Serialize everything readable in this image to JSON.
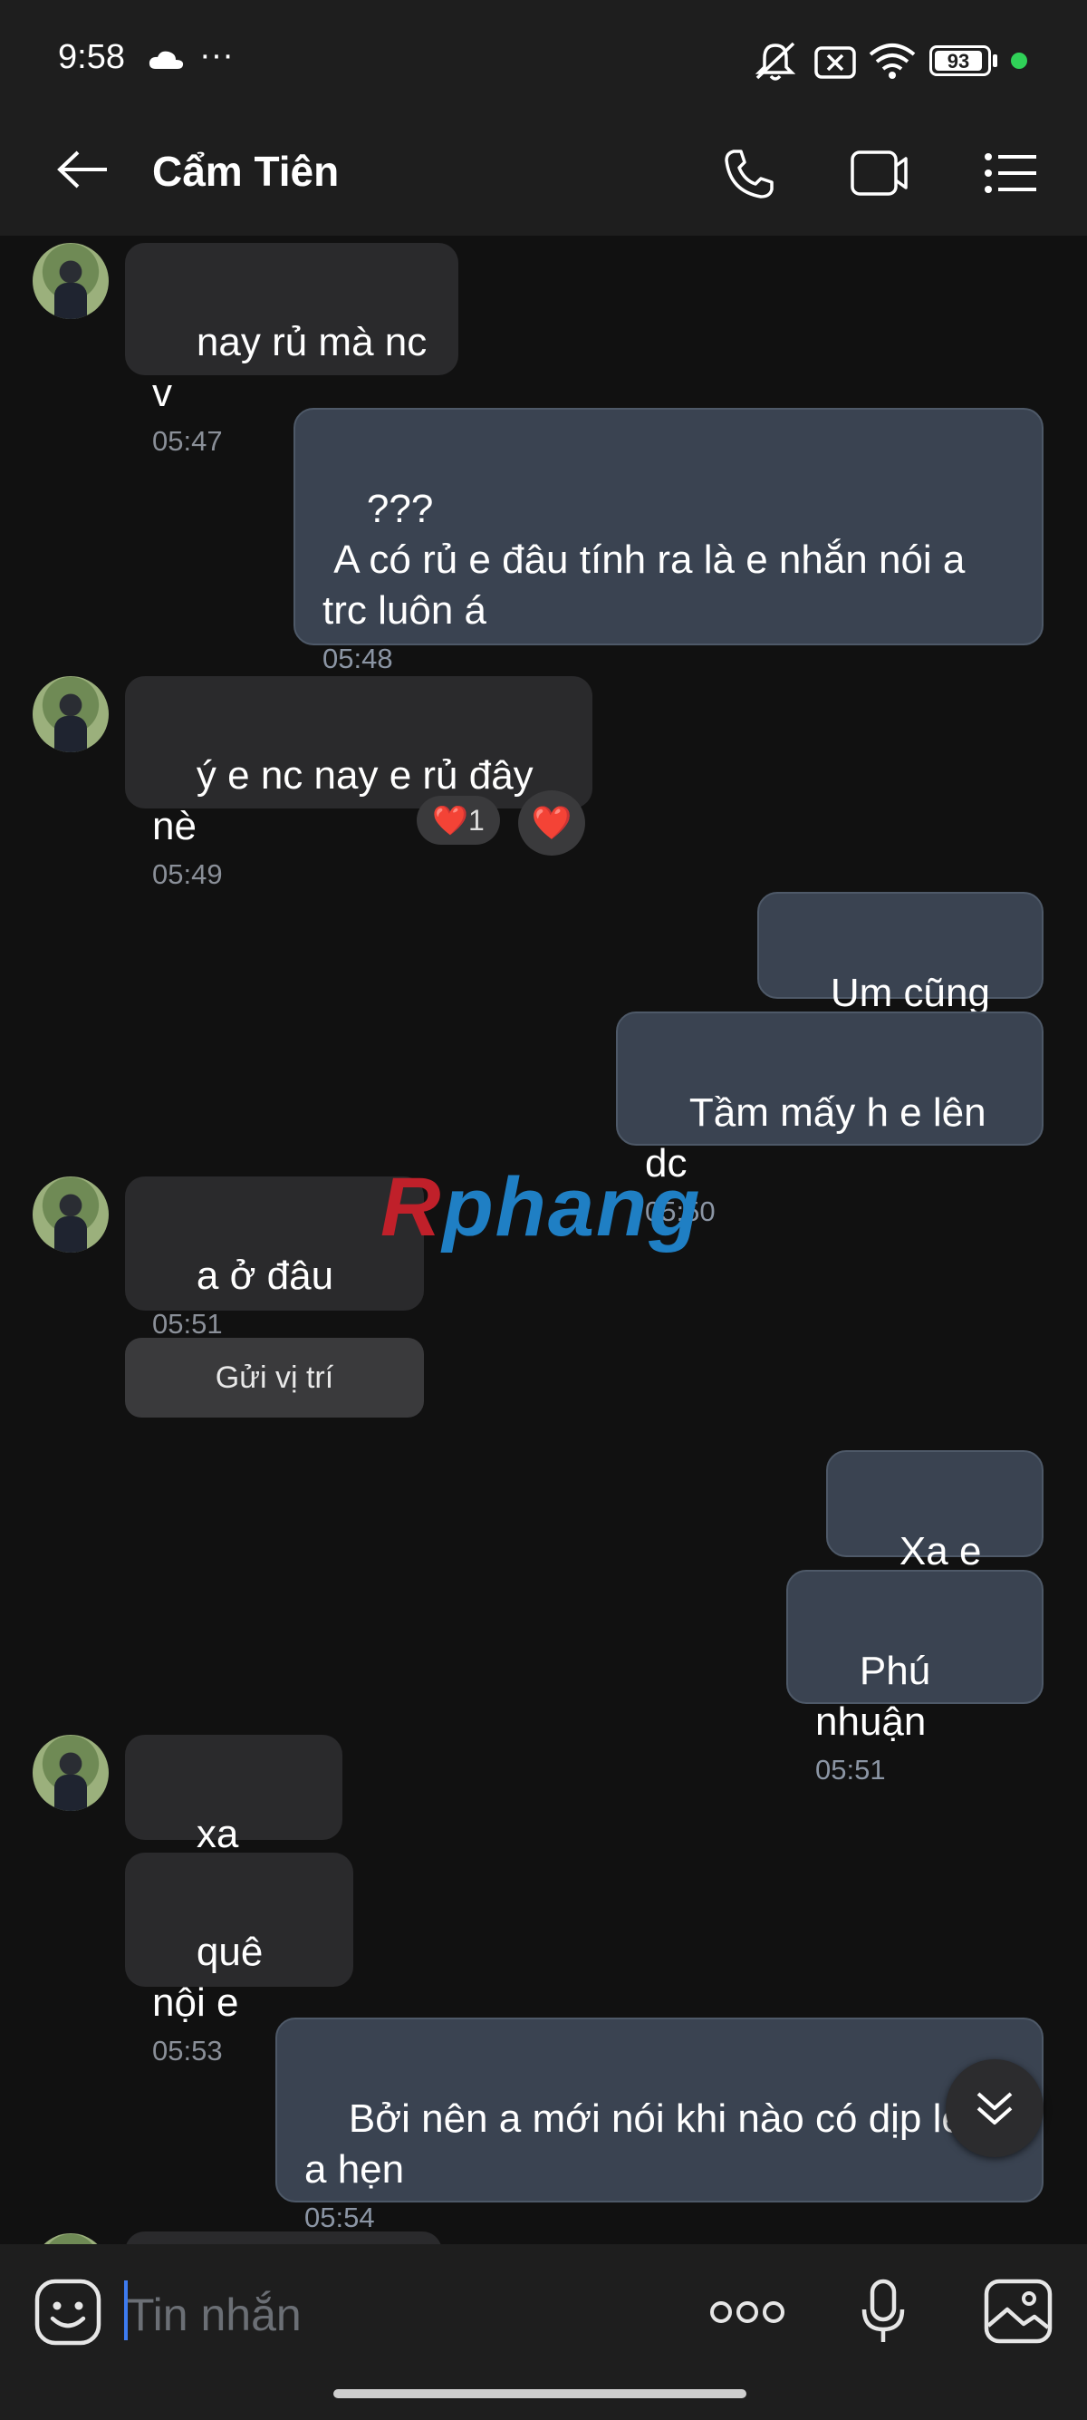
{
  "status_bar": {
    "time": "9:58",
    "more": "···",
    "battery": "93",
    "icons": [
      "cloud-icon",
      "mute-icon",
      "no-sim-icon",
      "wifi-icon",
      "battery-icon",
      "green-dot"
    ]
  },
  "header": {
    "contact_name": "Cẩm Tiên",
    "icons": [
      "back-arrow-icon",
      "phone-icon",
      "video-icon",
      "menu-list-icon"
    ]
  },
  "messages": [
    {
      "side": "in",
      "text": "nay rủ mà nc v",
      "time": "05:47"
    },
    {
      "side": "out",
      "text": "???\n A có rủ e đâu tính ra là e nhắn nói a trc luôn á",
      "time": "05:48"
    },
    {
      "side": "in",
      "text": "ý e nc nay e rủ đây nè",
      "time": "05:49",
      "reactions": {
        "count_label": "❤️1",
        "heart": "❤️"
      }
    },
    {
      "side": "out",
      "text": "Um cũng đc",
      "time": ""
    },
    {
      "side": "out",
      "text": "Tầm mấy h e lên dc",
      "time": "05:50"
    },
    {
      "side": "in",
      "text": "a ở đâu",
      "time": "05:51"
    },
    {
      "side": "out",
      "text": "Xa e á",
      "time": ""
    },
    {
      "side": "out",
      "text": "Phú nhuận",
      "time": "05:51"
    },
    {
      "side": "in",
      "text": "xa thttt",
      "time": ""
    },
    {
      "side": "in",
      "text": "quê nội e",
      "time": "05:53"
    },
    {
      "side": "out",
      "text": "Bởi nên a mới nói khi nào có dịp lên a hẹn",
      "time": "05:54"
    }
  ],
  "send_location_label": "Gửi vị trí",
  "watermark": {
    "first": "R",
    "rest": "phang"
  },
  "input": {
    "placeholder": "Tin nhắn",
    "icons": [
      "sticker-icon",
      "more-dots-icon",
      "microphone-icon",
      "image-icon"
    ]
  },
  "colors": {
    "background": "#111111",
    "bar": "#1e1e1e",
    "incoming_bubble": "#2a2a2c",
    "outgoing_bubble": "#3a4351",
    "timestamp": "#8a8f98",
    "caret": "#3d7bf0"
  }
}
